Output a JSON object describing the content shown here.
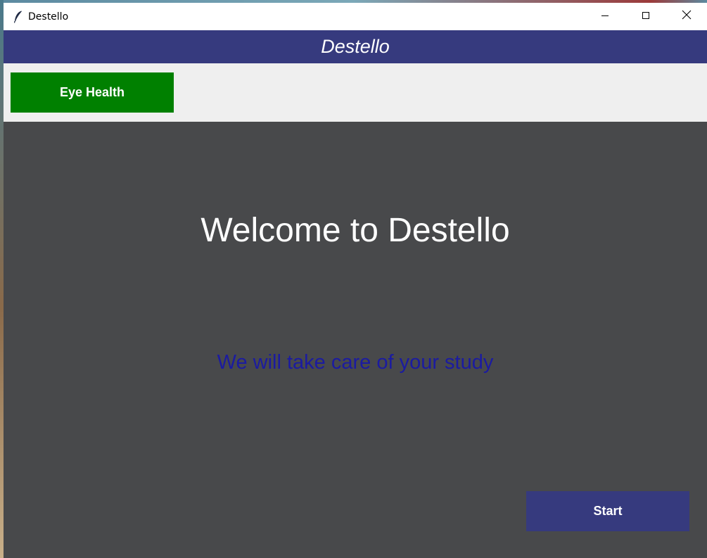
{
  "window": {
    "title": "Destello",
    "controls": {
      "minimize_icon": "minimize-icon",
      "maximize_icon": "maximize-icon",
      "close_icon": "close-icon"
    }
  },
  "header": {
    "title": "Destello"
  },
  "toolbar": {
    "eye_health_label": "Eye Health"
  },
  "main": {
    "welcome": "Welcome to Destello",
    "tagline": "We will take care of your study",
    "start_label": "Start"
  },
  "colors": {
    "header_bg": "#363a7e",
    "toolbar_bg": "#efefef",
    "eye_health_bg": "#008000",
    "main_bg": "#48494b",
    "tagline_text": "#1b1ba0",
    "start_bg": "#363a7e"
  }
}
